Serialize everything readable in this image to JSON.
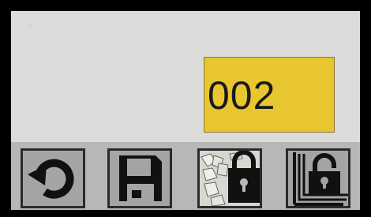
{
  "screen": {
    "faint_label": "X...",
    "value": "002",
    "value_box_color": "#e8c630"
  },
  "toolbar": {
    "buttons": [
      {
        "id": "undo",
        "icon": "undo-arrow-icon"
      },
      {
        "id": "save",
        "icon": "floppy-disk-icon"
      },
      {
        "id": "map-lock",
        "icon": "map-lock-icon"
      },
      {
        "id": "book-lock",
        "icon": "book-lock-icon"
      }
    ]
  }
}
